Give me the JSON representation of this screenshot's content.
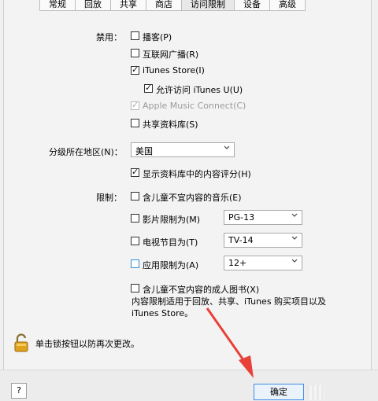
{
  "tabs": [
    "常规",
    "回放",
    "共享",
    "商店",
    "访问限制",
    "设备",
    "高级"
  ],
  "active_tab_index": 4,
  "disabled_label": "禁用：",
  "disable_items": [
    {
      "label": "播客(P)",
      "checked": false
    },
    {
      "label": "互联网广播(R)",
      "checked": false
    },
    {
      "label": "iTunes Store(I)",
      "checked": true
    },
    {
      "label": "允许访问 iTunes U(U)",
      "checked": true
    },
    {
      "label": "Apple Music Connect(C)",
      "checked": true,
      "disabled": true
    },
    {
      "label": "共享资料库(S)",
      "checked": false
    }
  ],
  "region": {
    "label": "分级所在地区(N)：",
    "value": "美国"
  },
  "show_ratings": {
    "label": "显示资料库中的内容评分(H)",
    "checked": true
  },
  "restrict_label": "限制：",
  "restrictions": [
    {
      "label": "含儿童不宜内容的音乐(E)",
      "checked": false
    },
    {
      "label": "影片限制为(M)",
      "checked": false,
      "value": "PG-13"
    },
    {
      "label": "电视节目为(T)",
      "checked": false,
      "value": "TV-14"
    },
    {
      "label": "应用限制为(A)",
      "checked": false,
      "value": "12+"
    },
    {
      "label": "含儿童不宜内容的成人图书(X)",
      "checked": false
    }
  ],
  "note_line1": "内容限制适用于回放、共享、iTunes 购买项目以及",
  "note_line2": "iTunes Store。",
  "lock_text": "单击锁按钮以防再次更改。",
  "help_label": "?",
  "ok_label": "确定",
  "colors": {
    "accent": "#3d8ee4",
    "arrow": "#e8413a"
  },
  "icons": {
    "lock": "lock-icon",
    "dropdown": "chevron-down-icon",
    "help": "help-icon"
  }
}
